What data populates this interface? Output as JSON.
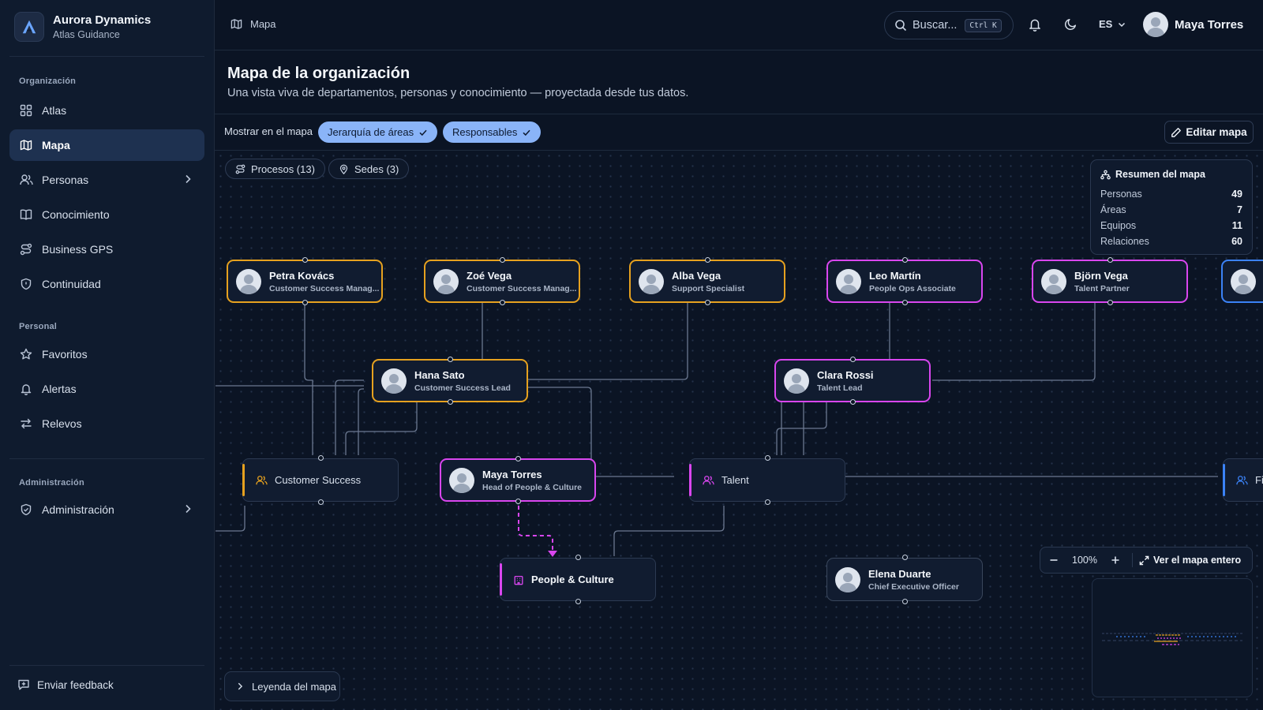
{
  "brand": {
    "name": "Aurora Dynamics",
    "subtitle": "Atlas Guidance",
    "logo_icon": "aurora-a-logo"
  },
  "sidebar": {
    "sections": [
      {
        "label": "Organización"
      },
      {
        "label": "Personal"
      },
      {
        "label": "Administración"
      }
    ],
    "items": [
      {
        "label": "Atlas",
        "icon": "grid-icon"
      },
      {
        "label": "Mapa",
        "icon": "map-icon",
        "active": true
      },
      {
        "label": "Personas",
        "icon": "users-icon",
        "has_children": true
      },
      {
        "label": "Conocimiento",
        "icon": "book-icon"
      },
      {
        "label": "Business GPS",
        "icon": "route-icon"
      },
      {
        "label": "Continuidad",
        "icon": "shield-icon"
      },
      {
        "label": "Favoritos",
        "icon": "star-icon"
      },
      {
        "label": "Alertas",
        "icon": "bell-icon"
      },
      {
        "label": "Relevos",
        "icon": "arrows-icon"
      },
      {
        "label": "Administración",
        "icon": "shield-check-icon",
        "has_children": true
      }
    ],
    "feedback": "Enviar feedback"
  },
  "topbar": {
    "breadcrumb": "Mapa",
    "search_placeholder": "Buscar...",
    "search_shortcut": "Ctrl K",
    "language": "ES",
    "user_name": "Maya Torres"
  },
  "page": {
    "title": "Mapa de la organización",
    "subtitle": "Una vista viva de departamentos, personas y conocimiento — proyectada desde tus datos."
  },
  "filters": {
    "label": "Mostrar en el mapa",
    "chips": [
      {
        "label": "Jerarquía de áreas",
        "checked": true
      },
      {
        "label": "Responsables",
        "checked": true
      }
    ],
    "edit_button": "Editar mapa"
  },
  "canvas": {
    "tags": [
      {
        "label": "Procesos (13)"
      },
      {
        "label": "Sedes (3)"
      }
    ],
    "people": [
      {
        "name": "Petra Kovács",
        "role": "Customer Success Manag...",
        "accent": "#e6a11f"
      },
      {
        "name": "Zoé Vega",
        "role": "Customer Success Manag...",
        "accent": "#e6a11f"
      },
      {
        "name": "Alba Vega",
        "role": "Support Specialist",
        "accent": "#e6a11f"
      },
      {
        "name": "Leo Martín",
        "role": "People Ops Associate",
        "accent": "#d946ef"
      },
      {
        "name": "Björn Vega",
        "role": "Talent Partner",
        "accent": "#d946ef"
      },
      {
        "name": "",
        "role": "",
        "accent": "#3b82f6"
      },
      {
        "name": "Hana Sato",
        "role": "Customer Success Lead",
        "accent": "#e6a11f"
      },
      {
        "name": "Clara Rossi",
        "role": "Talent Lead",
        "accent": "#d946ef"
      },
      {
        "name": "Maya Torres",
        "role": "Head of People & Culture",
        "accent": "#d946ef"
      },
      {
        "name": "Elena Duarte",
        "role": "Chief Executive Officer",
        "accent": "#3a475c"
      }
    ],
    "areas": [
      {
        "label": "Customer Success",
        "accent": "#e6a11f",
        "icon": "users-icon"
      },
      {
        "label": "Talent",
        "accent": "#d946ef",
        "icon": "users-icon"
      },
      {
        "label": "People & Culture",
        "accent": "#d946ef",
        "icon": "building-icon"
      },
      {
        "label": "Firm",
        "accent": "#3b82f6",
        "icon": "users-icon"
      }
    ],
    "summary": {
      "title": "Resumen del mapa",
      "rows": [
        {
          "label": "Personas",
          "value": "49"
        },
        {
          "label": "Áreas",
          "value": "7"
        },
        {
          "label": "Equipos",
          "value": "11"
        },
        {
          "label": "Relaciones",
          "value": "60"
        }
      ]
    },
    "zoom": {
      "level": "100%",
      "fit_label": "Ver el mapa entero"
    },
    "legend_button": "Leyenda del mapa"
  },
  "colors": {
    "orange": "#e6a11f",
    "magenta": "#d946ef",
    "blue": "#3b82f6",
    "chip": "#8ab4f8"
  }
}
